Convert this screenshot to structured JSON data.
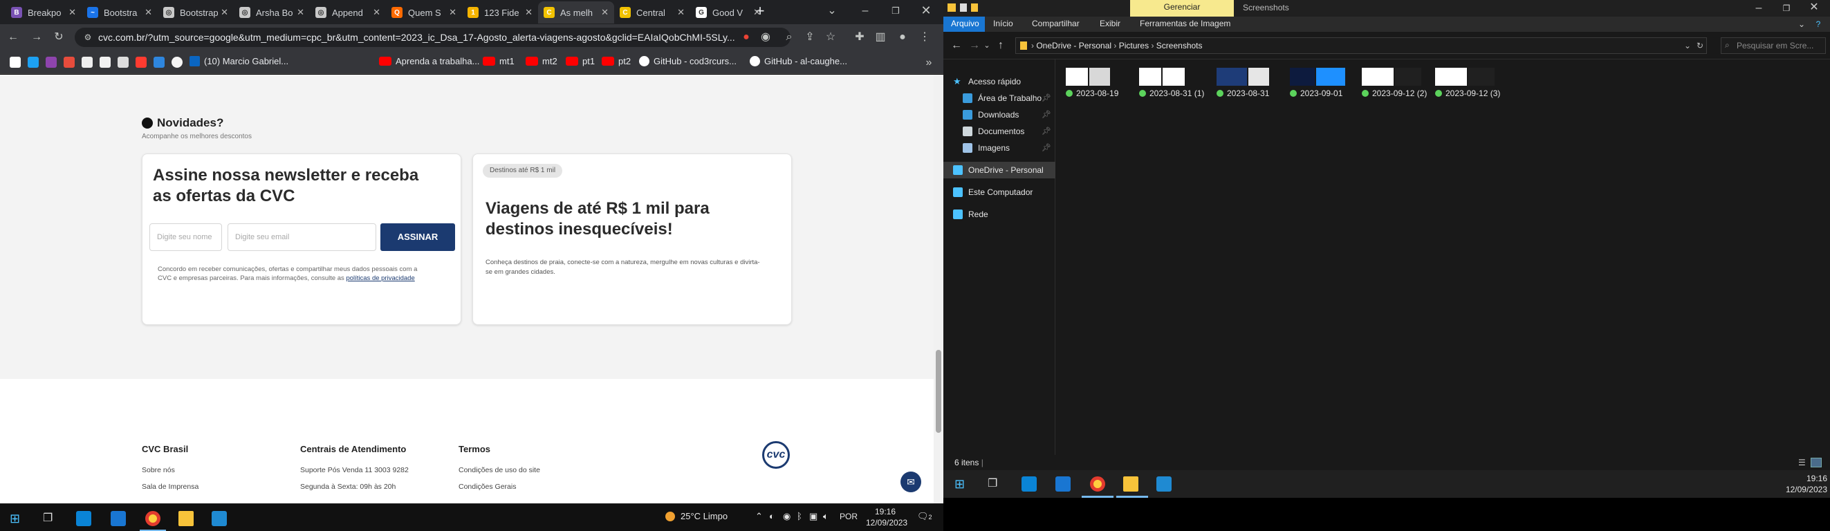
{
  "browser": {
    "tabs": [
      {
        "label": "Breakpo",
        "color": "#7952b3",
        "glyph": "B"
      },
      {
        "label": "Bootstra",
        "color": "#1a73e8",
        "glyph": "~"
      },
      {
        "label": "Bootstrap",
        "color": "#c9c9c9",
        "glyph": "◎"
      },
      {
        "label": "Arsha Bo",
        "color": "#c9c9c9",
        "glyph": "◎"
      },
      {
        "label": "Append",
        "color": "#c9c9c9",
        "glyph": "◎"
      },
      {
        "label": "Quem S",
        "color": "#ff6a00",
        "glyph": "Q"
      },
      {
        "label": "123 Fide",
        "color": "#f5b400",
        "glyph": "1"
      },
      {
        "label": "As melh",
        "color": "#f2c200",
        "glyph": "C"
      },
      {
        "label": "Central",
        "color": "#f2c200",
        "glyph": "C"
      },
      {
        "label": "Good V",
        "color": "#ffffff",
        "glyph": "G"
      }
    ],
    "active_tab_index": 7,
    "url": "cvc.com.br/?utm_source=google&utm_medium=cpc_br&utm_content=2023_ic_Dsa_17-Agosto_alerta-viagens-agosto&gclid=EAIaIQobChMI-5SLy...",
    "bookmarks": [
      {
        "label": "(10) Marcio Gabriel...",
        "type": "linkedin"
      },
      {
        "label": "Aprenda a trabalha...",
        "type": "youtube"
      },
      {
        "label": "mt1",
        "type": "youtube"
      },
      {
        "label": "mt2",
        "type": "youtube"
      },
      {
        "label": "pt1",
        "type": "youtube"
      },
      {
        "label": "pt2",
        "type": "youtube"
      },
      {
        "label": "GitHub - cod3rcurs...",
        "type": "github"
      },
      {
        "label": "GitHub - al-caughe...",
        "type": "github"
      }
    ]
  },
  "cvc_page": {
    "section_title": "Novidades?",
    "section_subtitle": "Acompanhe os melhores descontos",
    "newsletter": {
      "title_line1": "Assine nossa newsletter e receba",
      "title_line2": "as ofertas da CVC",
      "name_placeholder": "Digite seu nome",
      "email_placeholder": "Digite seu email",
      "button_label": "ASSINAR",
      "consent_line1": "Concordo em receber comunicações, ofertas e compartilhar meus dados pessoais com a",
      "consent_line2": "CVC e empresas parceiras. Para mais informações, consulte as",
      "privacy_link": "políticas de privacidade"
    },
    "promo": {
      "badge": "Destinos até R$ 1 mil",
      "title_line1": "Viagens de até R$ 1 mil para",
      "title_line2": "destinos inesquecíveis!",
      "desc_line1": "Conheça destinos de praia, conecte-se com a natureza, mergulhe em novas culturas e divirta-",
      "desc_line2": "se em grandes cidades."
    },
    "footer": {
      "col1": {
        "title": "CVC Brasil",
        "links": [
          "Sobre nós",
          "Sala de Imprensa"
        ]
      },
      "col2": {
        "title": "Centrais de Atendimento",
        "links": [
          "Suporte Pós Venda 11 3003 9282",
          "Segunda à Sexta: 09h às 20h"
        ]
      },
      "col3": {
        "title": "Termos",
        "links": [
          "Condições de uso do site",
          "Condições Gerais"
        ]
      },
      "logo": "cvc"
    }
  },
  "left_taskbar": {
    "weather": "25°C  Limpo",
    "lang": "POR",
    "time": "19:16",
    "date": "12/09/2023",
    "notif": "2"
  },
  "explorer": {
    "title_tabs": {
      "manage": "Gerenciar",
      "folder": "Screenshots"
    },
    "ribbon_tabs": [
      "Arquivo",
      "Início",
      "Compartilhar",
      "Exibir",
      "Ferramentas de Imagem"
    ],
    "breadcrumb": [
      "OneDrive - Personal",
      "Pictures",
      "Screenshots"
    ],
    "search_placeholder": "Pesquisar em Scre...",
    "sidebar": [
      {
        "label": "Acesso rápido",
        "icon": "star",
        "pinned": false
      },
      {
        "label": "Área de Trabalho",
        "icon": "desktop",
        "pinned": true
      },
      {
        "label": "Downloads",
        "icon": "download",
        "pinned": true
      },
      {
        "label": "Documentos",
        "icon": "document",
        "pinned": true
      },
      {
        "label": "Imagens",
        "icon": "image",
        "pinned": true
      },
      {
        "label": "OneDrive - Personal",
        "icon": "cloud",
        "pinned": false
      },
      {
        "label": "Este Computador",
        "icon": "computer",
        "pinned": false
      },
      {
        "label": "Rede",
        "icon": "network",
        "pinned": false
      }
    ],
    "files": [
      "2023-08-19",
      "2023-08-31 (1)",
      "2023-08-31",
      "2023-09-01",
      "2023-09-12 (2)",
      "2023-09-12 (3)"
    ],
    "status": "6 itens",
    "time": "19:16",
    "date": "12/09/2023"
  }
}
